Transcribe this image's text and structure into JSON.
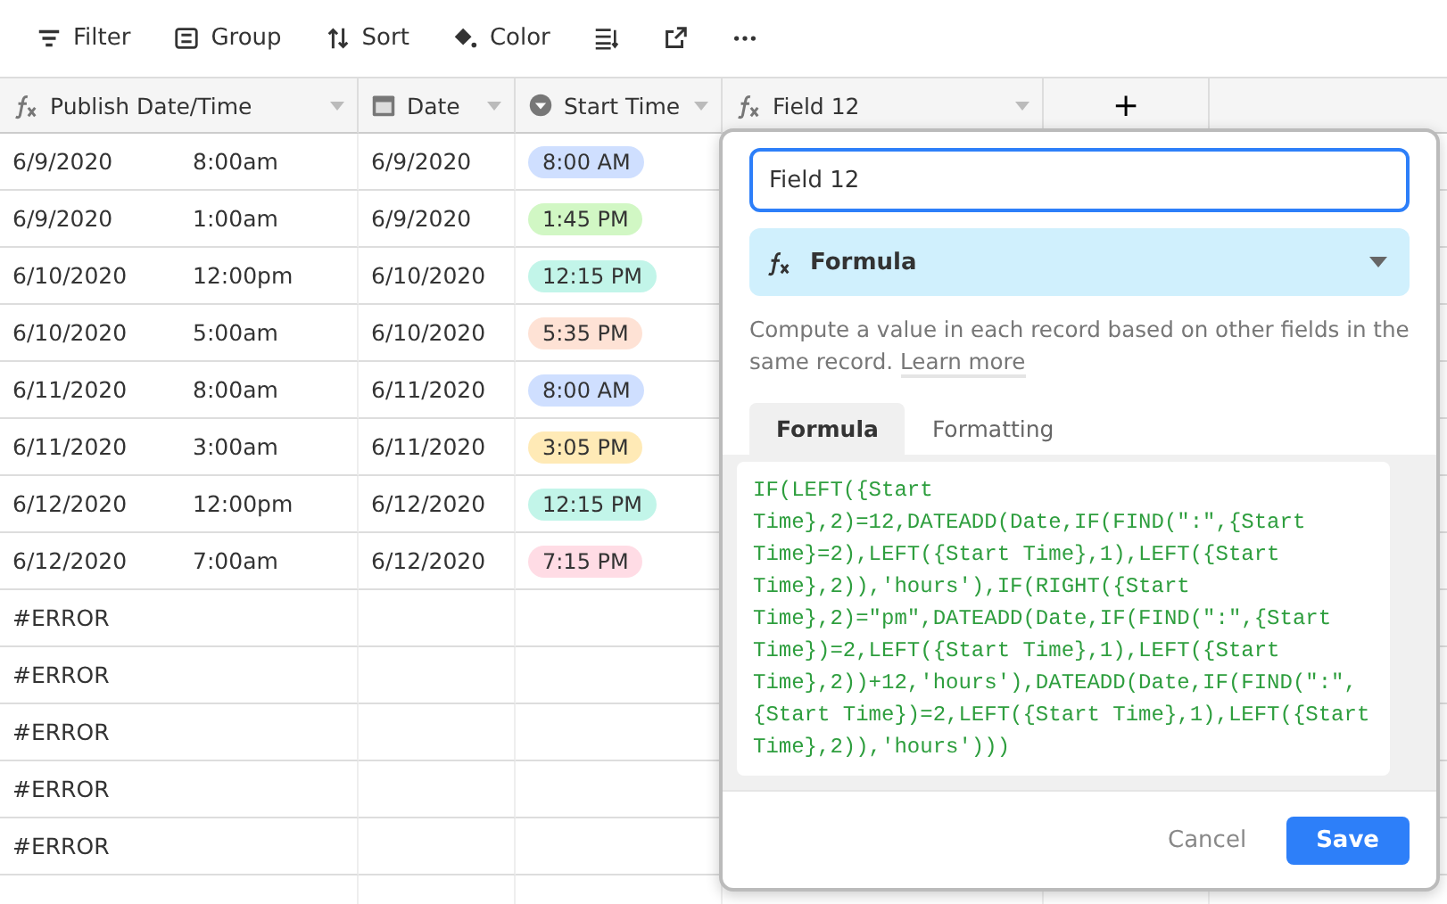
{
  "toolbar": [
    {
      "kind": "filter",
      "label": "Filter"
    },
    {
      "kind": "group",
      "label": "Group"
    },
    {
      "kind": "sort",
      "label": "Sort"
    },
    {
      "kind": "color",
      "label": "Color"
    },
    {
      "kind": "row-height"
    },
    {
      "kind": "share"
    },
    {
      "kind": "more"
    }
  ],
  "columns": [
    {
      "kind": "formula",
      "name": "Publish Date/Time"
    },
    {
      "kind": "date",
      "name": "Date"
    },
    {
      "kind": "select",
      "name": "Start Time"
    },
    {
      "kind": "formula",
      "name": "Field 12"
    }
  ],
  "add_column": "+",
  "rows": [
    {
      "publish_date": "6/9/2020",
      "publish_time": "8:00am",
      "date": "6/9/2020",
      "start_time": {
        "text": "8:00 AM",
        "color": "#cfdfff"
      }
    },
    {
      "publish_date": "6/9/2020",
      "publish_time": "1:00am",
      "date": "6/9/2020",
      "start_time": {
        "text": "1:45 PM",
        "color": "#d1f7c4"
      }
    },
    {
      "publish_date": "6/10/2020",
      "publish_time": "12:00pm",
      "date": "6/10/2020",
      "start_time": {
        "text": "12:15 PM",
        "color": "#c2f5e9"
      }
    },
    {
      "publish_date": "6/10/2020",
      "publish_time": "5:00am",
      "date": "6/10/2020",
      "start_time": {
        "text": "5:35 PM",
        "color": "#fee2d5"
      }
    },
    {
      "publish_date": "6/11/2020",
      "publish_time": "8:00am",
      "date": "6/11/2020",
      "start_time": {
        "text": "8:00 AM",
        "color": "#cfdfff"
      }
    },
    {
      "publish_date": "6/11/2020",
      "publish_time": "3:00am",
      "date": "6/11/2020",
      "start_time": {
        "text": "3:05 PM",
        "color": "#ffeab6"
      }
    },
    {
      "publish_date": "6/12/2020",
      "publish_time": "12:00pm",
      "date": "6/12/2020",
      "start_time": {
        "text": "12:15 PM",
        "color": "#c2f5e9"
      }
    },
    {
      "publish_date": "6/12/2020",
      "publish_time": "7:00am",
      "date": "6/12/2020",
      "start_time": {
        "text": "7:15 PM",
        "color": "#ffdce5"
      }
    },
    {
      "publish_date": "#ERROR"
    },
    {
      "publish_date": "#ERROR"
    },
    {
      "publish_date": "#ERROR"
    },
    {
      "publish_date": "#ERROR"
    },
    {
      "publish_date": "#ERROR"
    }
  ],
  "field_editor": {
    "name_value": "Field 12",
    "type": "Formula",
    "description": "Compute a value in each record based on other fields in the same record.",
    "link": "Learn more",
    "tabs": [
      {
        "label": "Formula",
        "selected": true
      },
      {
        "label": "Formatting",
        "selected": false
      }
    ],
    "formula": "IF(LEFT({Start Time},2)=12,DATEADD(Date,IF(FIND(\":\",{Start Time}=2),LEFT({Start Time},1),LEFT({Start Time},2)),'hours'),IF(RIGHT({Start Time},2)=\"pm\",DATEADD(Date,IF(FIND(\":\",{Start Time})=2,LEFT({Start Time},1),LEFT({Start Time},2))+12,'hours'),DATEADD(Date,IF(FIND(\":\",{Start Time})=2,LEFT({Start Time},1),LEFT({Start Time},2)),'hours')))",
    "cancel": "Cancel",
    "save": "Save"
  }
}
